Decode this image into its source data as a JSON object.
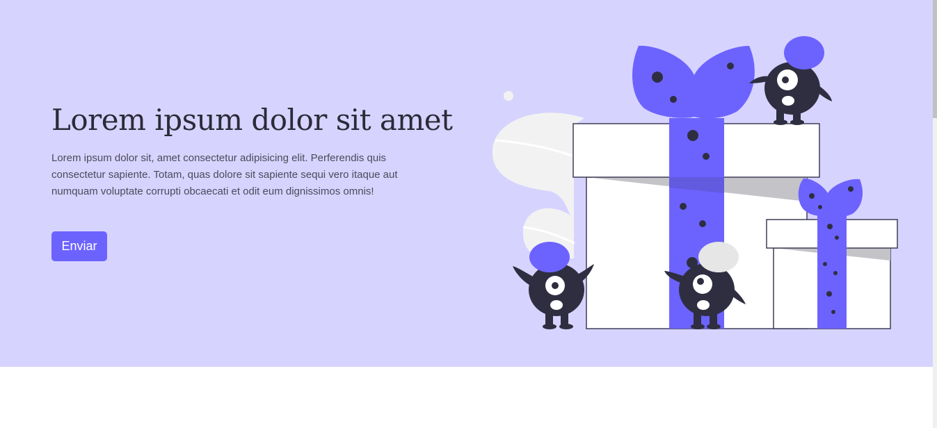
{
  "hero": {
    "title": "Lorem ipsum dolor sit amet",
    "text": "Lorem ipsum dolor sit, amet consectetur adipisicing elit. Perferendis quis consectetur sapiente. Totam, quas dolore sit sapiente sequi vero itaque aut numquam voluptate corrupti obcaecati et odit eum dignissimos omnis!",
    "button_label": "Enviar"
  },
  "illustration": {
    "icon": "gift-boxes-with-monsters-illustration"
  },
  "colors": {
    "hero_background": "#d7d3ff",
    "accent": "#6c63ff",
    "monster": "#2f2e41",
    "title": "#2b2b38",
    "text": "#4b4a5a"
  }
}
